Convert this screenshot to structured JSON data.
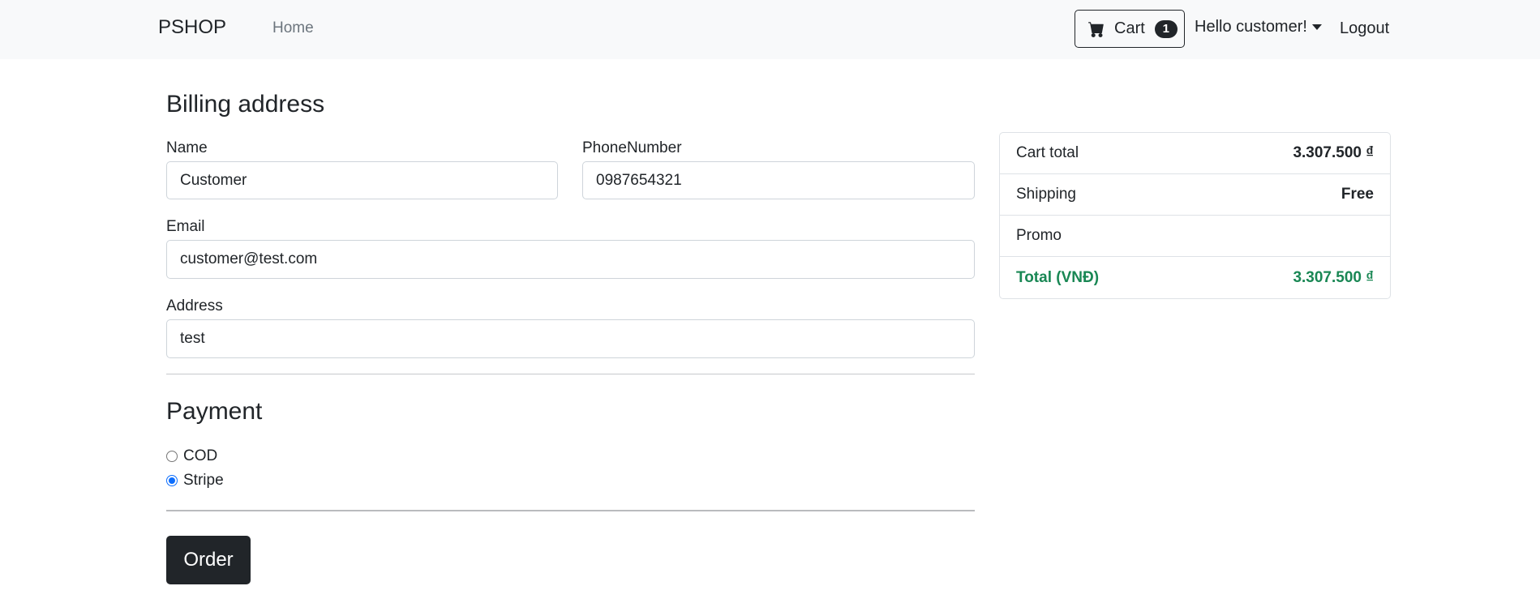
{
  "navbar": {
    "brand": "PSHOP",
    "home_label": "Home",
    "cart_label": "Cart",
    "cart_count": "1",
    "user_label": "Hello customer!",
    "logout_label": "Logout"
  },
  "billing": {
    "heading": "Billing address",
    "name_label": "Name",
    "name_value": "Customer",
    "phone_label": "PhoneNumber",
    "phone_value": "0987654321",
    "email_label": "Email",
    "email_value": "customer@test.com",
    "address_label": "Address",
    "address_value": "test"
  },
  "payment": {
    "heading": "Payment",
    "options": [
      {
        "label": "COD",
        "checked": false
      },
      {
        "label": "Stripe",
        "checked": true
      }
    ],
    "order_label": "Order"
  },
  "summary": {
    "rows": [
      {
        "label": "Cart total",
        "value": "3.307.500 ₫"
      },
      {
        "label": "Shipping",
        "value": "Free"
      },
      {
        "label": "Promo",
        "value": ""
      },
      {
        "label": "Total (VNĐ)",
        "value": "3.307.500 ₫"
      }
    ]
  },
  "colors": {
    "accent": "#0d6efd",
    "success": "#198754",
    "dark": "#212529"
  },
  "icons": {
    "cart": "cart-icon",
    "caret": "chevron-down-icon"
  }
}
